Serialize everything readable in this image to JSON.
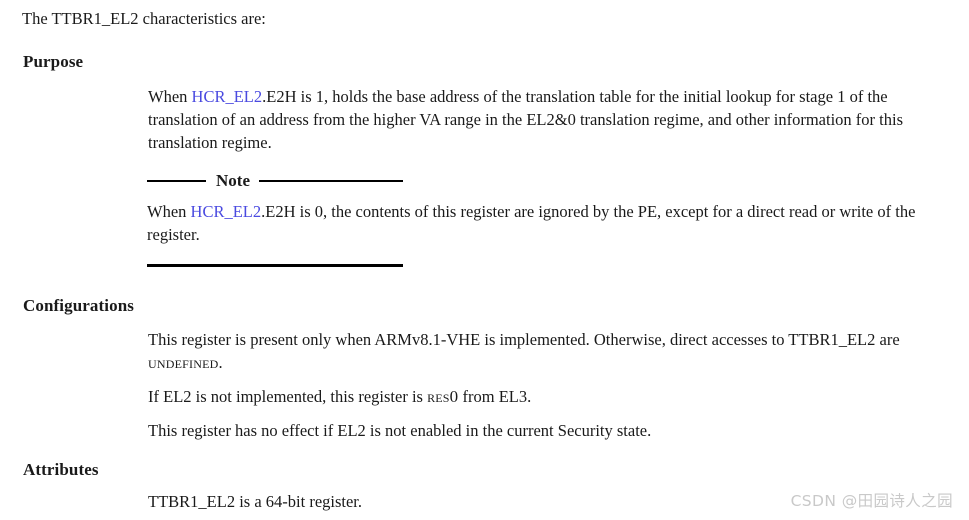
{
  "document": {
    "register_name": "TTBR1_EL2",
    "intro": {
      "text": "The TTBR1_EL2 characteristics are:"
    },
    "sections": [
      {
        "id": "purpose",
        "heading": "Purpose",
        "paragraph_prefix": "When ",
        "link_label": "HCR_EL2",
        "paragraph_suffix": ".E2H is 1, holds the base address of the translation table for the initial lookup for stage 1 of the translation of an address from the higher VA range in the EL2&0 translation regime, and other information for this translation regime."
      },
      {
        "id": "configurations",
        "heading": "Configurations",
        "paragraphs": [
          {
            "part1": "This register is present only when ARMv8.1-VHE is implemented. Otherwise, direct accesses to TTBR1_EL2 are ",
            "smallcaps": "UNDEFINED",
            "part2": "."
          },
          {
            "part1": "If EL2 is not implemented, this register is ",
            "smallcaps": "RES0",
            "part2": " from EL3."
          },
          {
            "part1": "This register has no effect if EL2 is not enabled in the current Security state.",
            "smallcaps": "",
            "part2": ""
          }
        ]
      },
      {
        "id": "attributes",
        "heading": "Attributes",
        "paragraph": "TTBR1_EL2 is a 64-bit register."
      }
    ],
    "note": {
      "label": "Note",
      "text_prefix": "When ",
      "link_label": "HCR_EL2",
      "text_suffix": ".E2H is 0, the contents of this register are ignored by the PE, except for a direct read or write of the register."
    },
    "watermark": {
      "text": "CSDN @田园诗人之园"
    },
    "colors": {
      "link": "#4a4ae0",
      "text": "#1a1a1a",
      "rule": "#000000",
      "watermark": "#c9c9c9",
      "background": "#ffffff"
    }
  }
}
